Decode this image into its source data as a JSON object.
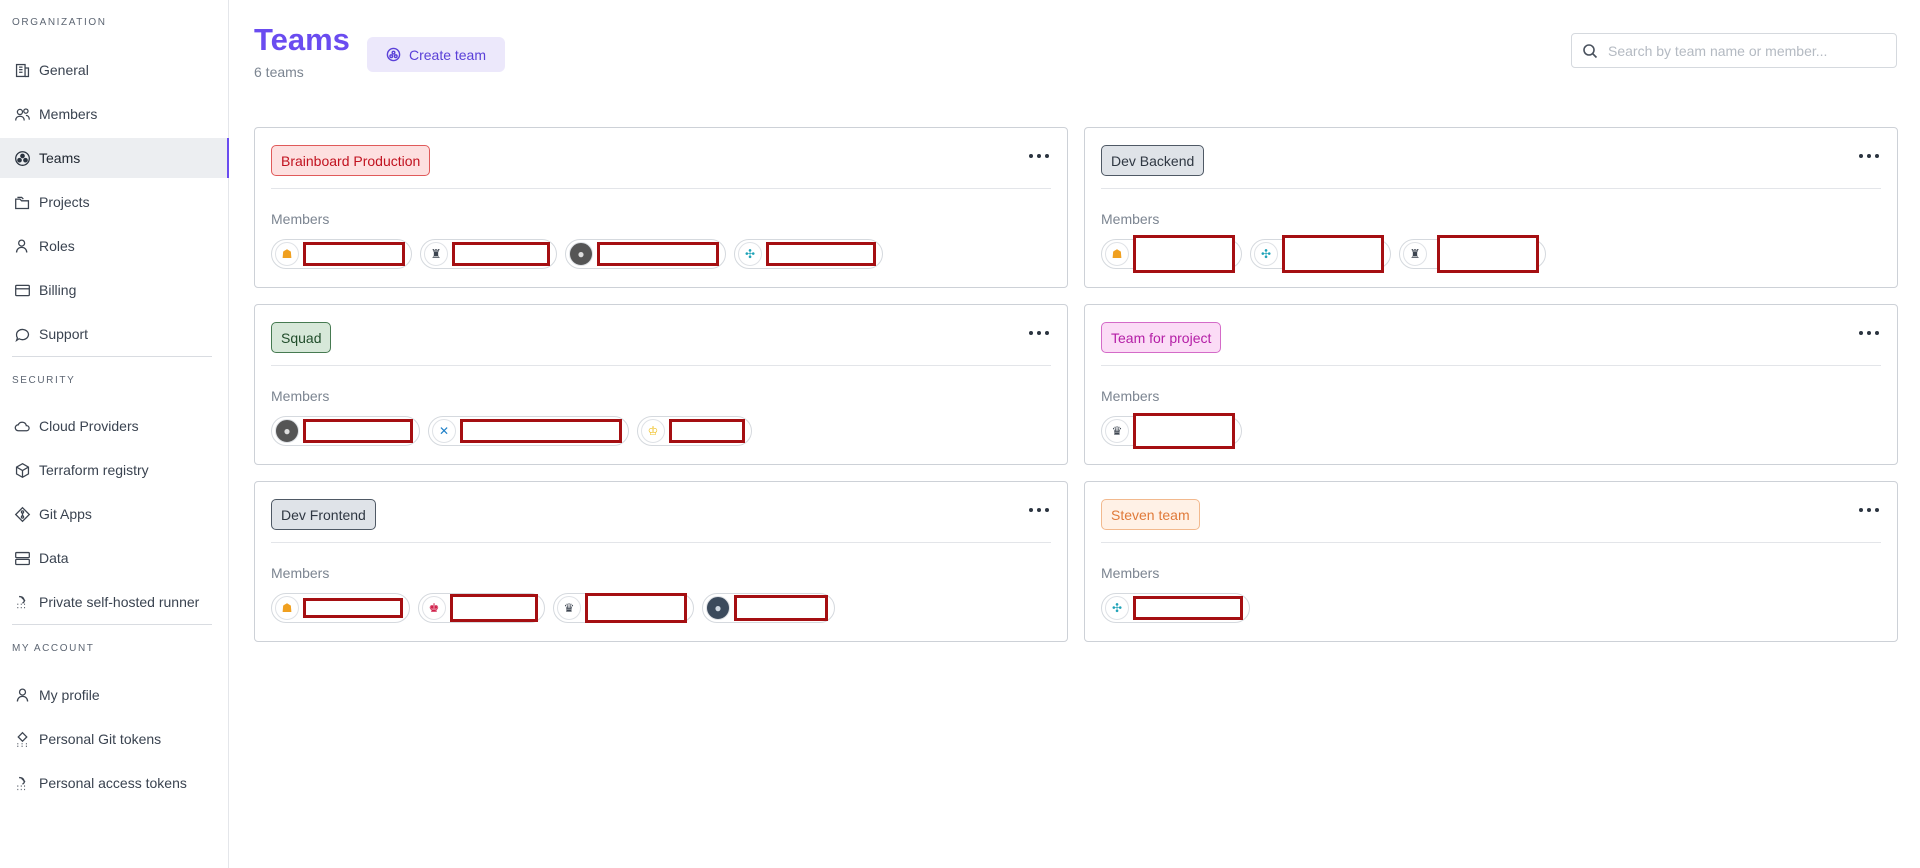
{
  "sidebar": {
    "section_org": "ORGANIZATION",
    "section_security": "SECURITY",
    "section_account": "MY ACCOUNT",
    "org_items": [
      {
        "label": "General",
        "icon": "building-icon"
      },
      {
        "label": "Members",
        "icon": "users-icon"
      },
      {
        "label": "Teams",
        "icon": "teams-icon"
      },
      {
        "label": "Projects",
        "icon": "folders-icon"
      },
      {
        "label": "Roles",
        "icon": "user-role-icon"
      },
      {
        "label": "Billing",
        "icon": "credit-card-icon"
      },
      {
        "label": "Support",
        "icon": "chat-bubble-icon"
      }
    ],
    "security_items": [
      {
        "label": "Cloud Providers",
        "icon": "cloud-icon"
      },
      {
        "label": "Terraform registry",
        "icon": "cube-icon"
      },
      {
        "label": "Git Apps",
        "icon": "git-icon"
      },
      {
        "label": "Data",
        "icon": "database-icon"
      },
      {
        "label": "Private self-hosted runner",
        "icon": "runner-icon"
      }
    ],
    "account_items": [
      {
        "label": "My profile",
        "icon": "user-icon"
      },
      {
        "label": "Personal Git tokens",
        "icon": "git-token-icon"
      },
      {
        "label": "Personal access tokens",
        "icon": "access-token-icon"
      }
    ],
    "active": "Teams"
  },
  "header": {
    "title": "Teams",
    "subtitle": "6 teams",
    "create_label": "Create team",
    "search_placeholder": "Search by team name or member..."
  },
  "teams": [
    {
      "name": "Brainboard Production",
      "members_label": "Members",
      "color": "#c1121f",
      "bg": "#fde0e0",
      "border": "#e05a5a"
    },
    {
      "name": "Dev Backend",
      "members_label": "Members",
      "color": "#2f3742",
      "bg": "#dfe3e8",
      "border": "#4f5965"
    },
    {
      "name": "Squad",
      "members_label": "Members",
      "color": "#214d2b",
      "bg": "#d7e8d9",
      "border": "#467a51"
    },
    {
      "name": "Team for project",
      "members_label": "Members",
      "color": "#b41ea6",
      "bg": "#fbdcf6",
      "border": "#d46bc8"
    },
    {
      "name": "Dev Frontend",
      "members_label": "Members",
      "color": "#2f3742",
      "bg": "#dfe3e8",
      "border": "#4f5965"
    },
    {
      "name": "Steven team",
      "members_label": "Members",
      "color": "#e07a3a",
      "bg": "#fff1e6",
      "border": "#f2b98e"
    }
  ],
  "colors": {
    "accent": "#6a4cf0",
    "redaction": "#a50f12"
  }
}
